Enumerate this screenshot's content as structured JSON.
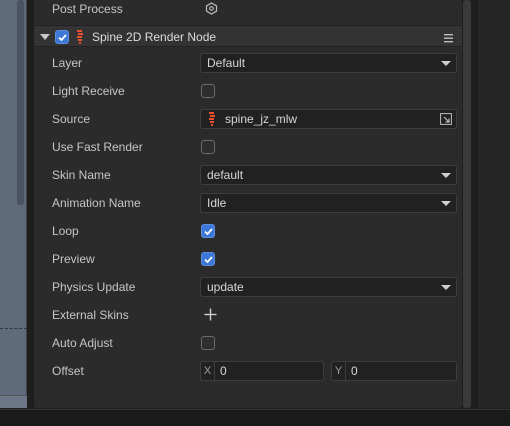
{
  "post_process": {
    "label": "Post Process",
    "icon": "hexagon-icon"
  },
  "component": {
    "title": "Spine 2D Render Node",
    "enabled": true,
    "icon": "spine-icon",
    "menu_icon": "menu-icon"
  },
  "fields": {
    "layer": {
      "label": "Layer",
      "value": "Default"
    },
    "light_receive": {
      "label": "Light Receive",
      "checked": false
    },
    "source": {
      "label": "Source",
      "value": "spine_jz_mlw"
    },
    "use_fast_render": {
      "label": "Use Fast Render",
      "checked": false
    },
    "skin_name": {
      "label": "Skin Name",
      "value": "default"
    },
    "animation_name": {
      "label": "Animation Name",
      "value": "Idle"
    },
    "loop": {
      "label": "Loop",
      "checked": true
    },
    "preview": {
      "label": "Preview",
      "checked": true
    },
    "physics_update": {
      "label": "Physics Update",
      "value": "update"
    },
    "external_skins": {
      "label": "External Skins"
    },
    "auto_adjust": {
      "label": "Auto Adjust",
      "checked": false
    },
    "offset": {
      "label": "Offset",
      "x_axis": "X",
      "x": "0",
      "y_axis": "Y",
      "y": "0"
    }
  },
  "colors": {
    "accent": "#3d78d8",
    "spine_icon": "#e8512b",
    "panel": "#2b2b2b"
  }
}
